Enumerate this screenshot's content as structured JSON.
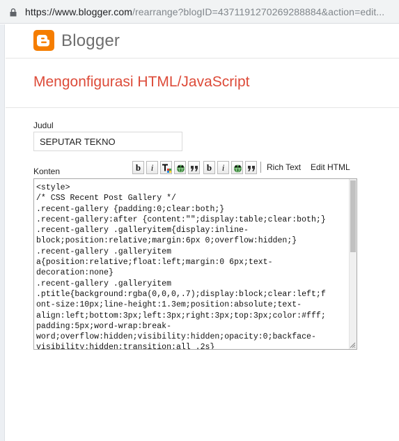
{
  "browser": {
    "url_host": "https://www.blogger.com",
    "url_path": "/rearrange?blogID=4371191270269288884&action=edit..."
  },
  "header": {
    "brand": "Blogger",
    "brand_color": "#f57d00"
  },
  "page": {
    "title": "Mengonfigurasi HTML/JavaScript",
    "title_color": "#dd4b39"
  },
  "form": {
    "title_label": "Judul",
    "title_value": "SEPUTAR TEKNO",
    "content_label": "Konten",
    "content_value": "<style>\n/* CSS Recent Post Gallery */\n.recent-gallery {padding:0;clear:both;}\n.recent-gallery:after {content:\"\";display:table;clear:both;}\n.recent-gallery .galleryitem{display:inline-\nblock;position:relative;margin:6px 0;overflow:hidden;}\n.recent-gallery .galleryitem\na{position:relative;float:left;margin:0 6px;text-\ndecoration:none}\n.recent-gallery .galleryitem\n.ptitle{background:rgba(0,0,0,.7);display:block;clear:left;f\nont-size:10px;line-height:1.3em;position:absolute;text-\nalign:left;bottom:3px;left:3px;right:3px;top:3px;color:#fff;\npadding:5px;word-wrap:break-\nword;overflow:hidden;visibility:hidden;opacity:0;backface-\nvisibility:hidden;transition:all .2s}"
  },
  "toolbar": {
    "bold": "b",
    "italic": "i",
    "rich_text": "Rich Text",
    "edit_html": "Edit HTML"
  },
  "icons": [
    "lock-icon",
    "blogger-logo-icon",
    "text-color-icon",
    "link-icon",
    "quote-icon",
    "resize-grip-icon"
  ]
}
